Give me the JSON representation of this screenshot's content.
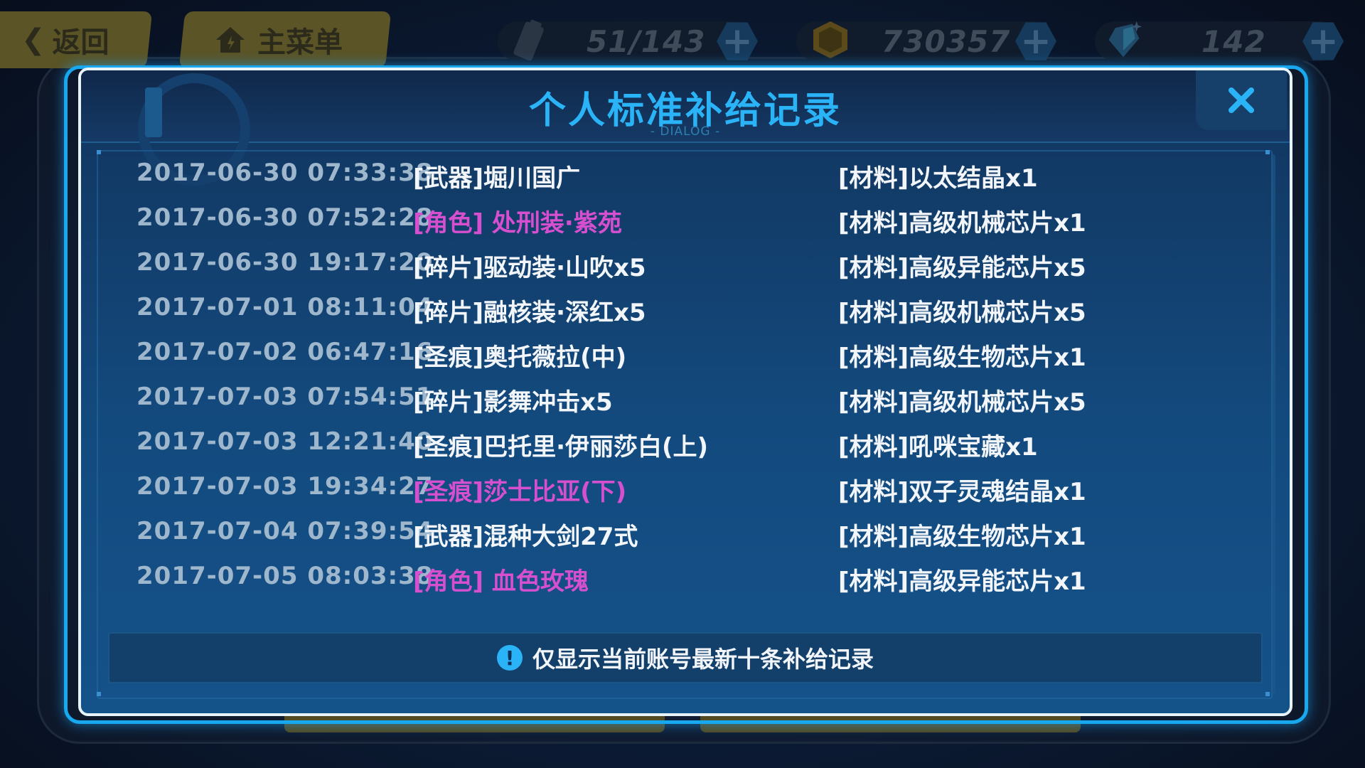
{
  "hud": {
    "back_label": "返回",
    "home_label": "主菜单",
    "stamina": "51/143",
    "coins": "730357",
    "crystals": "142"
  },
  "dialog": {
    "title": "个人标准补给记录",
    "subtitle": "- DIALOG -",
    "notice": "仅显示当前账号最新十条补给记录"
  },
  "records": [
    {
      "time": "2017-06-30 07:33:38",
      "item": "[武器]堀川国广",
      "material": "[材料]以太结晶x1",
      "rare": false
    },
    {
      "time": "2017-06-30 07:52:28",
      "item": "[角色] 处刑装·紫苑",
      "material": "[材料]高级机械芯片x1",
      "rare": true
    },
    {
      "time": "2017-06-30 19:17:20",
      "item": "[碎片]驱动装·山吹x5",
      "material": "[材料]高级异能芯片x5",
      "rare": false
    },
    {
      "time": "2017-07-01 08:11:04",
      "item": "[碎片]融核装·深红x5",
      "material": "[材料]高级机械芯片x5",
      "rare": false
    },
    {
      "time": "2017-07-02 06:47:16",
      "item": "[圣痕]奥托薇拉(中)",
      "material": "[材料]高级生物芯片x1",
      "rare": false
    },
    {
      "time": "2017-07-03 07:54:51",
      "item": "[碎片]影舞冲击x5",
      "material": "[材料]高级机械芯片x5",
      "rare": false
    },
    {
      "time": "2017-07-03 12:21:40",
      "item": "[圣痕]巴托里·伊丽莎白(上)",
      "material": "[材料]吼咪宝藏x1",
      "rare": false
    },
    {
      "time": "2017-07-03 19:34:27",
      "item": "[圣痕]莎士比亚(下)",
      "material": "[材料]双子灵魂结晶x1",
      "rare": true
    },
    {
      "time": "2017-07-04 07:39:54",
      "item": "[武器]混种大剑27式",
      "material": "[材料]高级生物芯片x1",
      "rare": false
    },
    {
      "time": "2017-07-05 08:03:38",
      "item": "[角色] 血色玫瑰",
      "material": "[材料]高级异能芯片x1",
      "rare": true
    }
  ],
  "colors": {
    "accent": "#2ab4f7",
    "rare_item": "#d64fcf",
    "normal_item": "#f2f6fa",
    "timestamp": "#9eb7cc"
  },
  "icons": {
    "back": "chevron-left-icon",
    "home": "home-icon",
    "stamina": "battery-icon",
    "coins": "coin-icon",
    "crystals": "crystal-icon",
    "close": "close-icon",
    "notice": "exclamation-icon"
  }
}
